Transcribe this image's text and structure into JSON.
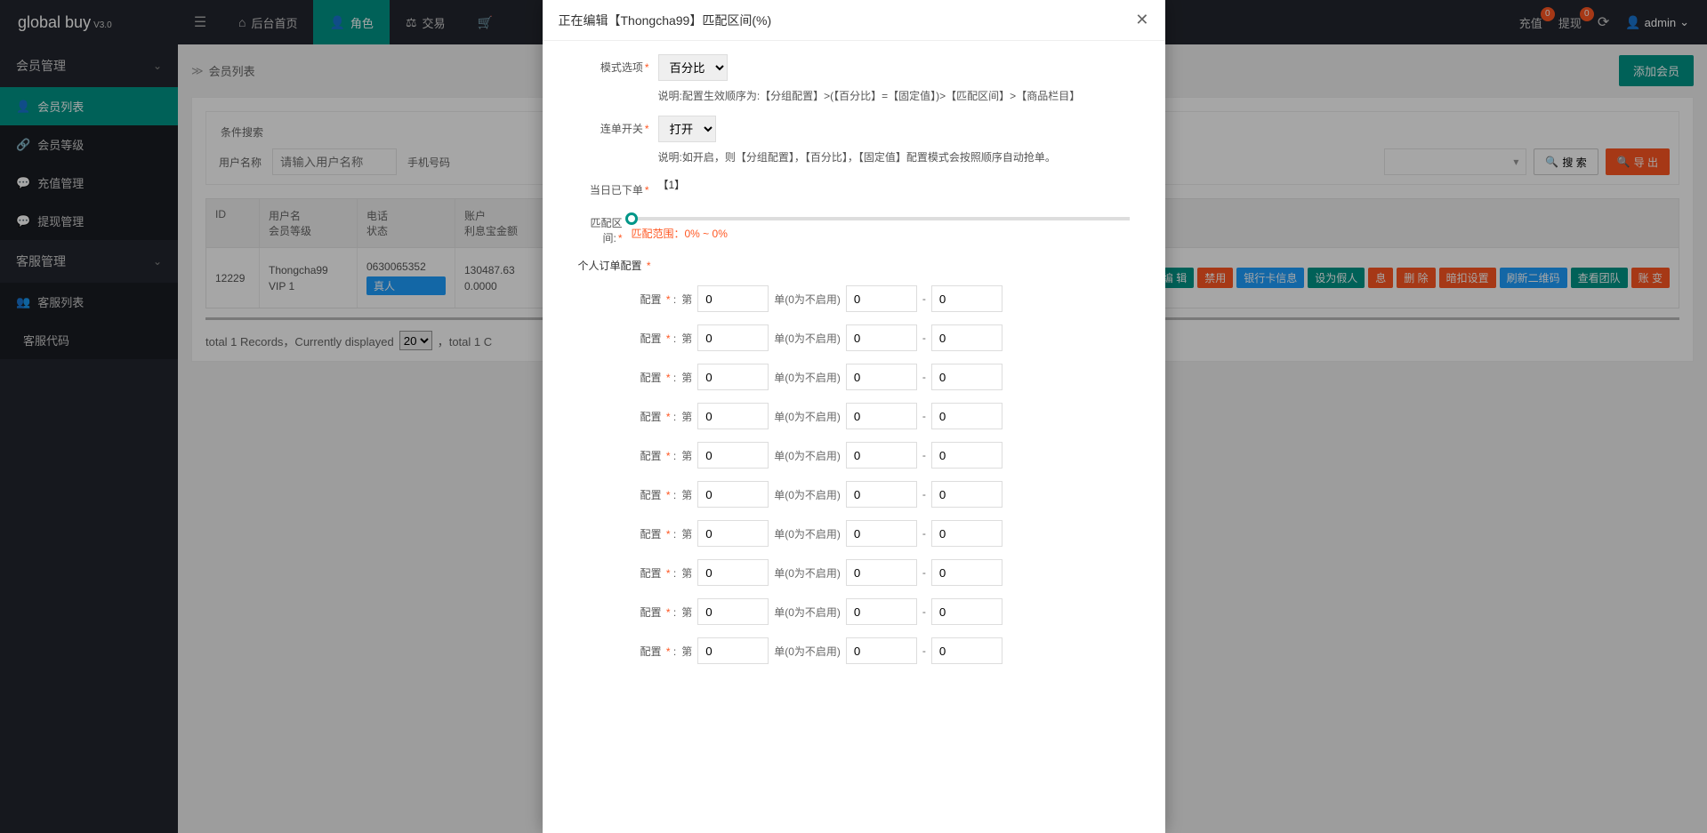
{
  "logo": {
    "name": "global buy",
    "ver": "V3.0"
  },
  "topnav": [
    {
      "label": "后台首页",
      "icon": "⌂"
    },
    {
      "label": "角色",
      "icon": "👤",
      "active": true
    },
    {
      "label": "交易",
      "icon": "⚖"
    },
    {
      "label": "",
      "icon": "🛒"
    }
  ],
  "header": {
    "recharge": "充值",
    "recharge_badge": "0",
    "withdraw": "提现",
    "withdraw_badge": "0",
    "user": "admin"
  },
  "sidebar": {
    "groups": [
      {
        "title": "会员管理",
        "open": true,
        "items": [
          {
            "label": "会员列表",
            "icon": "👤",
            "active": true
          },
          {
            "label": "会员等级",
            "icon": "🔗"
          },
          {
            "label": "充值管理",
            "icon": "💬"
          },
          {
            "label": "提现管理",
            "icon": "💬"
          }
        ]
      },
      {
        "title": "客服管理",
        "open": true,
        "items": [
          {
            "label": "客服列表",
            "icon": "👥"
          },
          {
            "label": "客服代码",
            "icon": "</>"
          }
        ]
      }
    ]
  },
  "breadcrumb": {
    "title": "会员列表",
    "add_btn": "添加会员"
  },
  "search": {
    "title": "条件搜索",
    "user_label": "用户名称",
    "user_ph": "请输入用户名称",
    "phone_label": "手机号码",
    "select_ph": "",
    "search_btn": "搜 索",
    "export_btn": "导 出"
  },
  "table": {
    "headers": {
      "id": "ID",
      "user1": "用户名",
      "user2": "会员等级",
      "phone1": "电话",
      "phone2": "状态",
      "acc1": "账户",
      "acc2": "利息宝金额"
    },
    "row": {
      "id": "12229",
      "username": "Thongcha99",
      "level": "VIP 1",
      "phone": "0630065352",
      "status": "真人",
      "acc1": "130487.63",
      "acc2": "0.0000"
    },
    "actions": [
      "编 辑",
      "禁用",
      "银行卡信息",
      "设为假人",
      "息",
      "删 除",
      "暗扣设置",
      "刷新二维码",
      "查看团队",
      "账 变"
    ],
    "action_colors": [
      "mb-green",
      "mb-red",
      "mb-blue",
      "mb-green",
      "mb-red",
      "mb-red",
      "mb-red",
      "mb-blue",
      "mb-green",
      "mb-red"
    ]
  },
  "pagination": {
    "t1": "total 1 Records，Currently displayed",
    "sel": "20",
    "t2": "，total 1 C"
  },
  "modal": {
    "title": "正在编辑【Thongcha99】匹配区间(%)",
    "mode_label": "模式选项",
    "mode_value": "百分比",
    "mode_note": "说明:配置生效顺序为:【分组配置】>(【百分比】=【固定值】)>【匹配区间】>【商品栏目】",
    "serial_label": "连单开关",
    "serial_value": "打开",
    "serial_note": "说明:如开启，则【分组配置】，【百分比】，【固定值】配置模式会按照顺序自动抢单。",
    "today_label": "当日已下单",
    "today_value": "【1】",
    "range_label": "匹配区间:",
    "range_text": "匹配范围：0% ~ 0%",
    "personal_label": "个人订单配置",
    "cfg": {
      "label": "配置",
      "di": "第",
      "mid": "单(0为不启用)",
      "dash": "-",
      "v1": "0",
      "v2": "0",
      "v3": "0"
    },
    "cfg_count": 10
  }
}
